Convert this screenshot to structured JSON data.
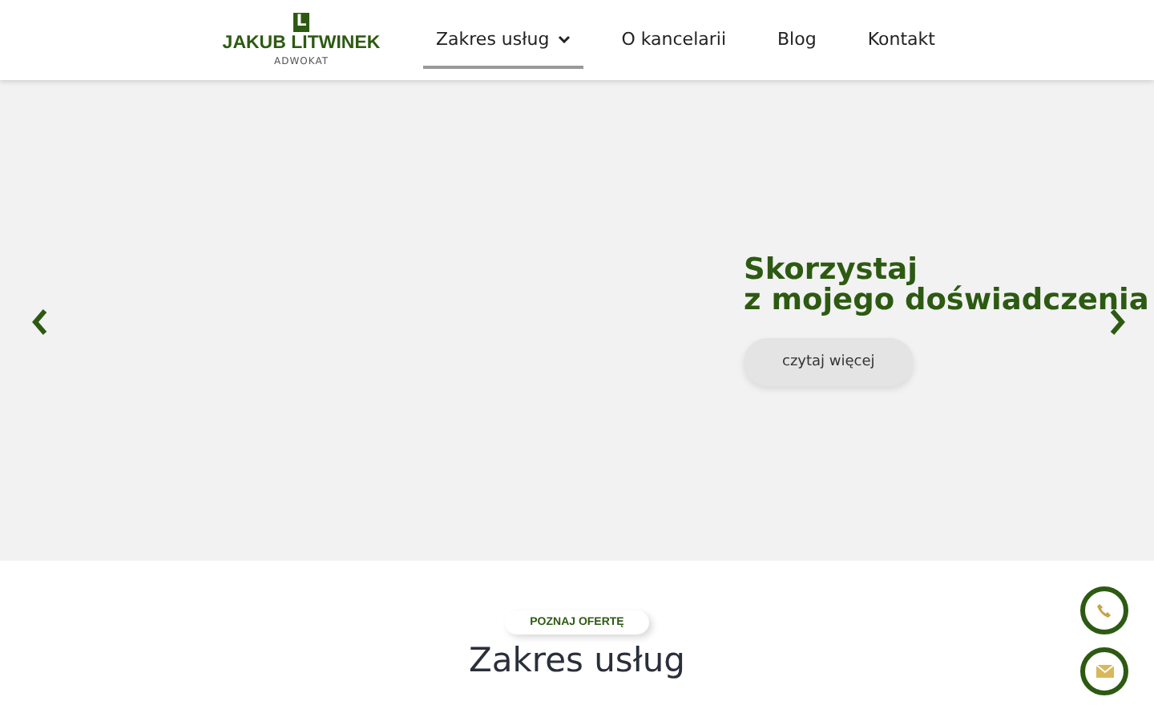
{
  "logo": {
    "mark": "L",
    "name": "JAKUB LITWINEK",
    "subtitle": "ADWOKAT"
  },
  "nav": [
    {
      "label": "Zakres usług",
      "selected": true,
      "dropdown": true
    },
    {
      "label": "O kancelarii",
      "selected": false,
      "dropdown": false
    },
    {
      "label": "Blog",
      "selected": false,
      "dropdown": false
    },
    {
      "label": "Kontakt",
      "selected": false,
      "dropdown": false
    }
  ],
  "hero": {
    "title_lines": [
      "Skorzystaj",
      "z mojego doświadczenia"
    ],
    "button": "czytaj więcej"
  },
  "section": {
    "badge": "POZNAJ OFERTĘ",
    "title": "Zakres usług"
  },
  "floating_buttons": [
    {
      "kind": "phone"
    },
    {
      "kind": "mail"
    }
  ]
}
